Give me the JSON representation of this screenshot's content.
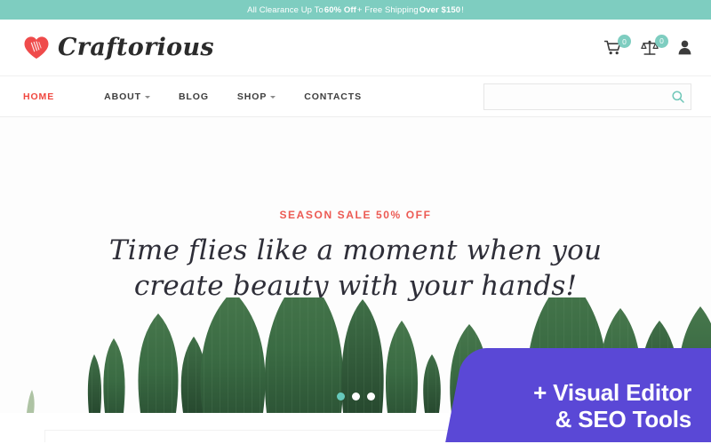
{
  "promo_strip": {
    "text_before": "All Clearance Up To ",
    "bold1": "60% Off",
    "text_middle": " + Free Shipping ",
    "bold2": "Over $150",
    "text_after": "!"
  },
  "header": {
    "logo_text": "Craftorious",
    "logo_icon": "heart-icon",
    "tools": [
      {
        "icon": "cart-icon",
        "name": "cart",
        "badge": "0"
      },
      {
        "icon": "scales-compare-icon",
        "name": "compare",
        "badge": "0"
      },
      {
        "icon": "user-account-icon",
        "name": "account",
        "badge": ""
      }
    ]
  },
  "nav": {
    "items": [
      {
        "label": "HOME",
        "active": true,
        "dropdown": false
      },
      {
        "label": "ABOUT",
        "active": false,
        "dropdown": true
      },
      {
        "label": "BLOG",
        "active": false,
        "dropdown": false
      },
      {
        "label": "SHOP",
        "active": false,
        "dropdown": true
      },
      {
        "label": "CONTACTS",
        "active": false,
        "dropdown": false
      }
    ]
  },
  "search": {
    "value": "",
    "placeholder": "",
    "icon": "search-icon"
  },
  "hero": {
    "sale_label": "SEASON SALE 50% OFF",
    "title": "Time flies like a moment when you create beauty with your hands!",
    "carousel_dots": [
      {
        "active": true
      },
      {
        "active": false
      },
      {
        "active": false
      }
    ]
  },
  "promo_badge": {
    "line1": "+ Visual Editor",
    "line2": "& SEO Tools"
  },
  "colors": {
    "strip_teal": "#7ecdc0",
    "accent_red": "#f0473f",
    "sale_red": "#ec5a53",
    "badge_teal": "#7ecdc0",
    "dot_active_teal": "#66c9bb",
    "promo_purple": "#5a48d6",
    "leaf_green": "#3a6b43",
    "heart_red": "#ef4b4b",
    "hero_bg": "#fdfdfd",
    "text_dark": "#2e2e38"
  }
}
